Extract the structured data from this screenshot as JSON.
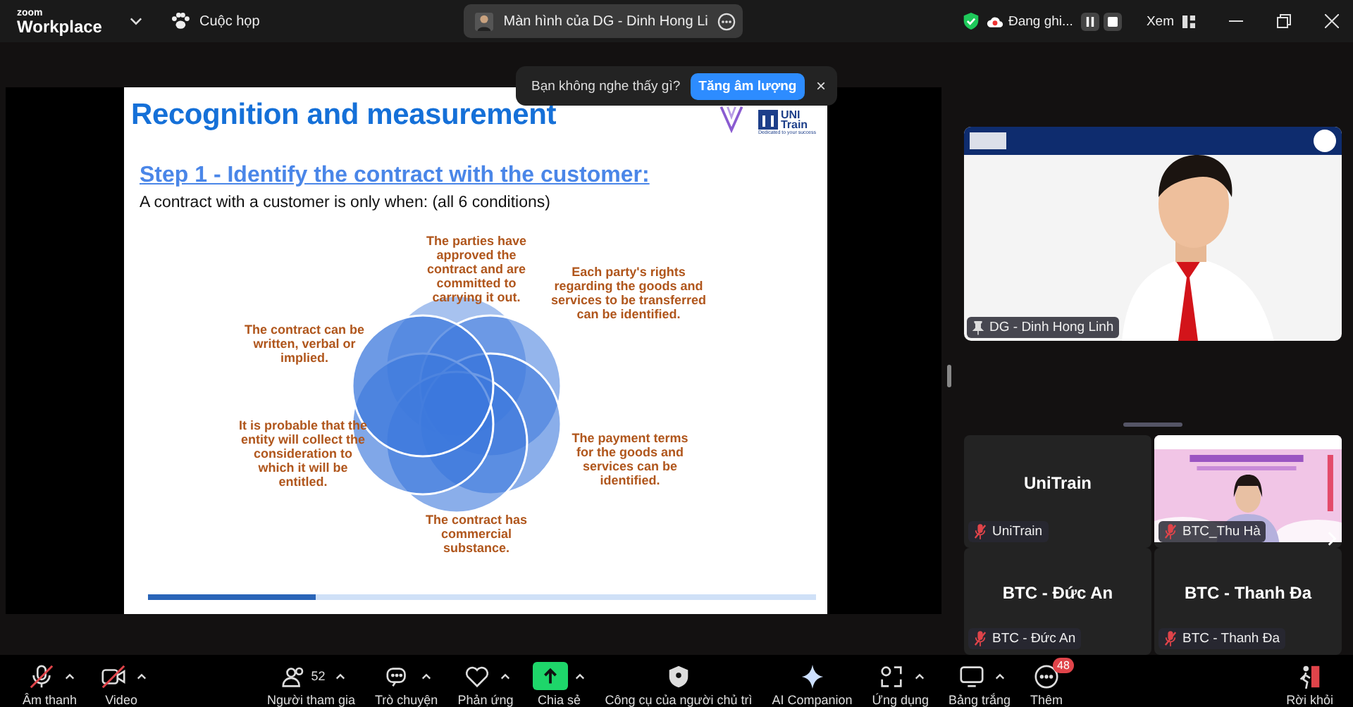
{
  "top_bar": {
    "brand_small": "zoom",
    "brand": "Workplace",
    "meeting": "Cuộc họp",
    "share_pill": "Màn hình của DG - Dinh Hong Li",
    "recording": "Đang ghi...",
    "view": "Xem"
  },
  "toast": {
    "text": "Bạn không nghe thấy gì?",
    "button": "Tăng âm lượng",
    "close": "×"
  },
  "slide": {
    "title": "Recognition and measurement",
    "logo_top": "UNI",
    "logo_bottom": "Train",
    "logo_tagline": "Dedicated to your success",
    "heading": "Step 1 - Identify the contract with the customer:",
    "intro": "A contract with a customer is only when: (all 6 conditions)",
    "conditions": [
      "The parties have approved the contract and are committed to carrying it out.",
      "Each party's rights regarding the goods and services to be transferred can be identified.",
      "The contract can be written, verbal or implied.",
      "It is probable that the entity will collect the consideration to which it will be entitled.",
      "The payment terms for the goods and services can be identified.",
      "The contract has commercial substance."
    ],
    "level": 0.25
  },
  "speaker": {
    "name": "DG - Dinh Hong Linh",
    "pinned": true
  },
  "tiles": [
    {
      "kind": "avatar",
      "title": "UniTrain",
      "name": "UniTrain",
      "muted": true
    },
    {
      "kind": "video",
      "name": "BTC_Thu Hà",
      "muted": true
    },
    {
      "kind": "avatar",
      "title": "BTC - Đức An",
      "name": "BTC - Đức An",
      "muted": true
    },
    {
      "kind": "avatar",
      "title": "BTC - Thanh Đa",
      "name": "BTC - Thanh Đa",
      "muted": true
    }
  ],
  "toolbar": [
    {
      "label": "Âm thanh",
      "off": true,
      "caret": true
    },
    {
      "label": "Video",
      "off": true,
      "caret": true
    },
    {
      "label": "Người tham gia",
      "count": "52",
      "off": false,
      "caret": true
    },
    {
      "label": "Trò chuyện",
      "off": false,
      "caret": true
    },
    {
      "label": "Phản ứng",
      "off": false,
      "caret": true
    },
    {
      "label": "Chia sẻ",
      "off": false,
      "caret": true
    },
    {
      "label": "Công cụ của người chủ trì",
      "off": false,
      "caret": false
    },
    {
      "label": "AI Companion",
      "off": false,
      "caret": false
    },
    {
      "label": "Ứng dụng",
      "off": false,
      "caret": true
    },
    {
      "label": "Bảng trắng",
      "off": false,
      "caret": true
    },
    {
      "label": "Thêm",
      "badge": "48",
      "off": false,
      "caret": false
    },
    {
      "label": "Rời khỏi",
      "off": false,
      "caret": false
    }
  ]
}
